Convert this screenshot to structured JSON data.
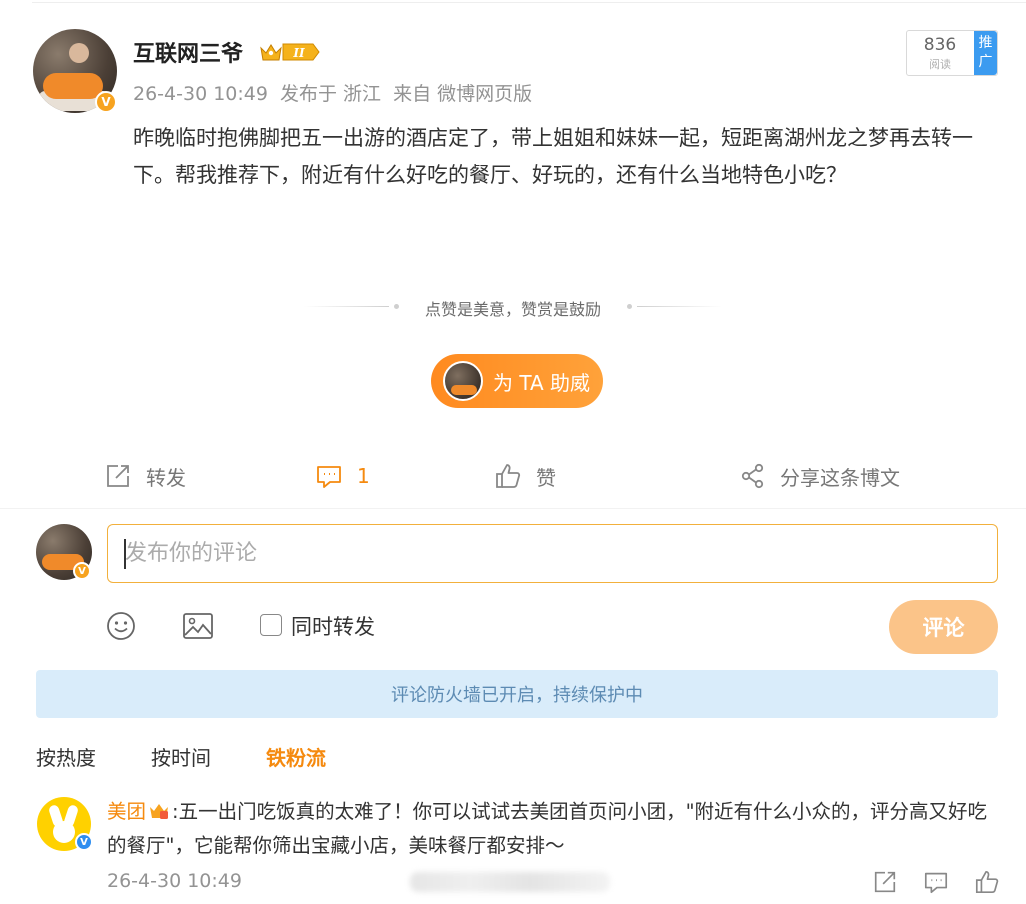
{
  "post": {
    "username": "互联网三爷",
    "time": "26-4-30 10:49",
    "location": "发布于 浙江",
    "source": "来自 微博网页版",
    "read_count": "836",
    "read_label": "阅读",
    "promote_label": "推广",
    "content": "昨晚临时抱佛脚把五一出游的酒店定了，带上姐姐和妹妹一起，短距离湖州龙之梦再去转一下。帮我推荐下，附近有什么好吃的餐厅、好玩的，还有什么当地特色小吃？",
    "reward_slogan": "点赞是美意，赞赏是鼓励",
    "cheer_label": "为 TA 助威",
    "level_badge": "II"
  },
  "actions": {
    "forward": "转发",
    "comment_count": "1",
    "like": "赞",
    "share": "分享这条博文"
  },
  "composer": {
    "placeholder": "发布你的评论",
    "also_forward_label": "同时转发",
    "submit_label": "评论"
  },
  "notice": "评论防火墙已开启，持续保护中",
  "sort_tabs": {
    "hot": "按热度",
    "time": "按时间",
    "fans": "铁粉流"
  },
  "comments": [
    {
      "user": "美团",
      "text": ":五一出门吃饭真的太难了！你可以试试去美团首页问小团，\"附近有什么小众的，评分高又好吃的餐厅\"，它能帮你筛出宝藏小店，美味餐厅都安排～",
      "time": "26-4-30 10:49"
    }
  ],
  "colors": {
    "accent": "#f58a0f",
    "verified_orange": "#f7a31f",
    "verified_blue": "#2f8ef0",
    "notice_bg": "#d9ecfa",
    "submit_bg": "#fbc489"
  }
}
